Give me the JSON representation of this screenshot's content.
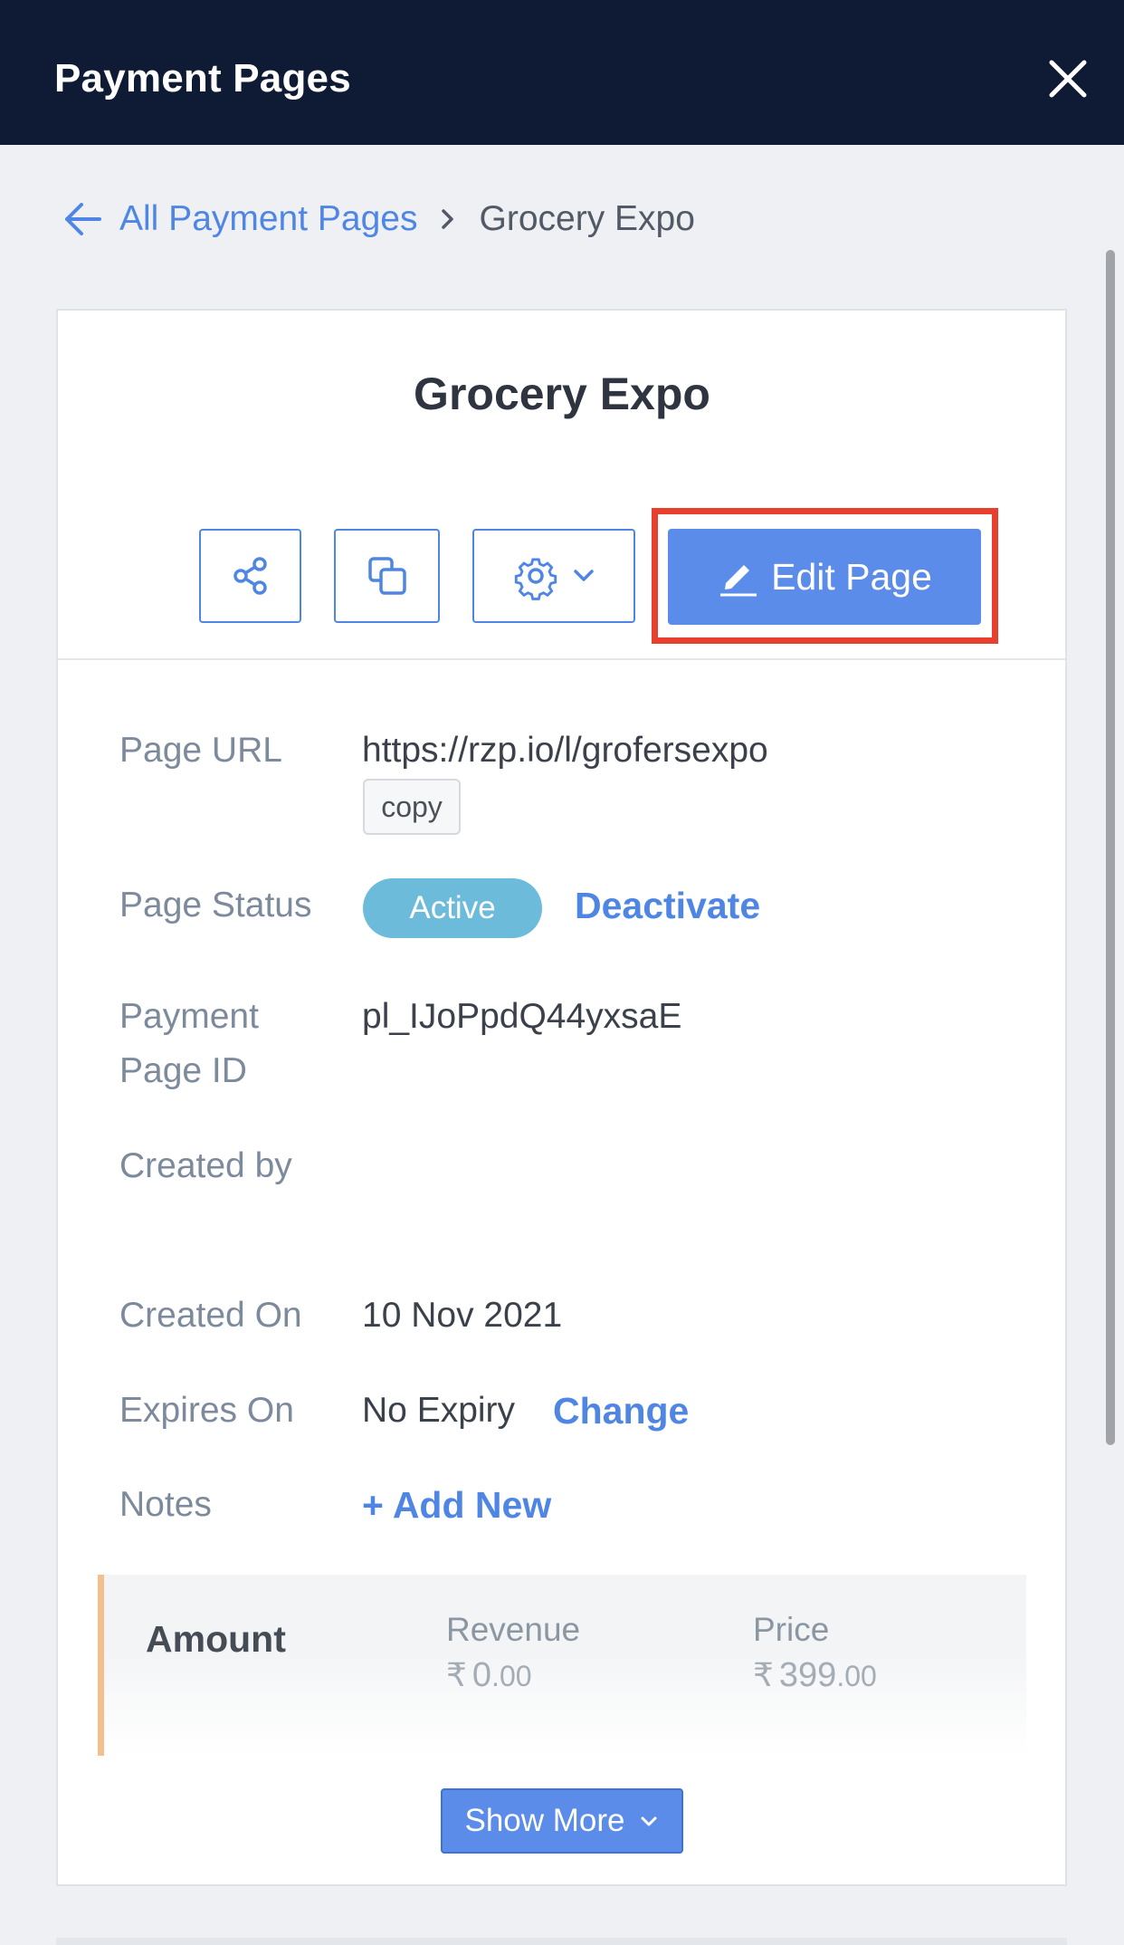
{
  "header": {
    "title": "Payment Pages",
    "close_icon": "close-icon"
  },
  "breadcrumb": {
    "back_icon": "arrow-left-icon",
    "parent": "All Payment Pages",
    "separator_icon": "chevron-right-icon",
    "current": "Grocery Expo"
  },
  "card": {
    "title": "Grocery Expo",
    "actions": {
      "share_icon": "share-icon",
      "duplicate_icon": "copy-icon",
      "settings_icon": "gear-icon",
      "edit_label": "Edit Page"
    },
    "details": {
      "page_url_label": "Page URL",
      "page_url_value": "https://rzp.io/l/grofersexpo",
      "copy_label": "copy",
      "status_label": "Page Status",
      "status_badge": "Active",
      "deactivate_label": "Deactivate",
      "page_id_label_line1": "Payment",
      "page_id_label_line2": "Page ID",
      "page_id_value": "pl_IJoPpdQ44yxsaE",
      "created_by_label": "Created by",
      "created_on_label": "Created On",
      "created_on_value": "10 Nov 2021",
      "expires_label": "Expires On",
      "expires_value": "No Expiry",
      "change_label": "Change",
      "notes_label": "Notes",
      "add_new_label": "+ Add New"
    },
    "amount": {
      "heading": "Amount",
      "revenue_label": "Revenue",
      "revenue_currency": "₹",
      "revenue_whole": "0",
      "revenue_decimal": ".00",
      "price_label": "Price",
      "price_currency": "₹",
      "price_whole": "399",
      "price_decimal": ".00"
    },
    "show_more_label": "Show More"
  },
  "colors": {
    "accent": "#5b8cea",
    "topbar": "#0f1a35",
    "highlight": "#e8402e",
    "active_badge": "#6cbbdb"
  }
}
